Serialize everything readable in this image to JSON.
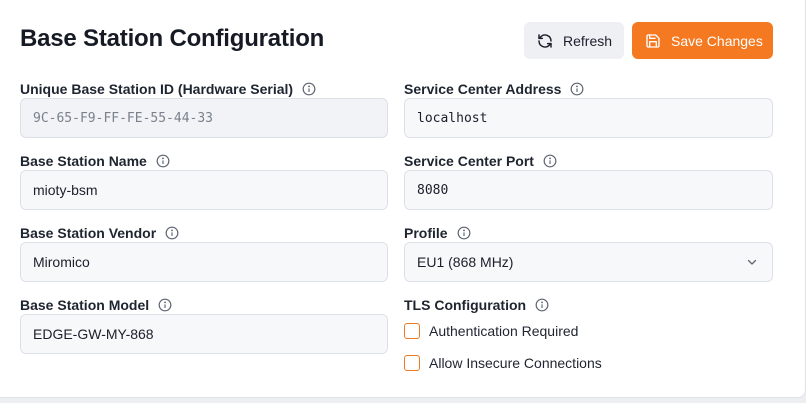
{
  "header": {
    "title": "Base Station Configuration",
    "refresh_label": "Refresh",
    "save_label": "Save Changes"
  },
  "left": {
    "id_label": "Unique Base Station ID (Hardware Serial)",
    "id_value": "9C-65-F9-FF-FE-55-44-33",
    "name_label": "Base Station Name",
    "name_value": "mioty-bsm",
    "vendor_label": "Base Station Vendor",
    "vendor_value": "Miromico",
    "model_label": "Base Station Model",
    "model_value": "EDGE-GW-MY-868"
  },
  "right": {
    "address_label": "Service Center Address",
    "address_value": "localhost",
    "port_label": "Service Center Port",
    "port_value": "8080",
    "profile_label": "Profile",
    "profile_value": "EU1 (868 MHz)",
    "tls_label": "TLS Configuration",
    "tls_options": [
      {
        "label": "Authentication Required",
        "checked": false
      },
      {
        "label": "Allow Insecure Connections",
        "checked": false
      }
    ]
  },
  "colors": {
    "accent": "#f47920",
    "checkbox_border": "#f07a22"
  }
}
